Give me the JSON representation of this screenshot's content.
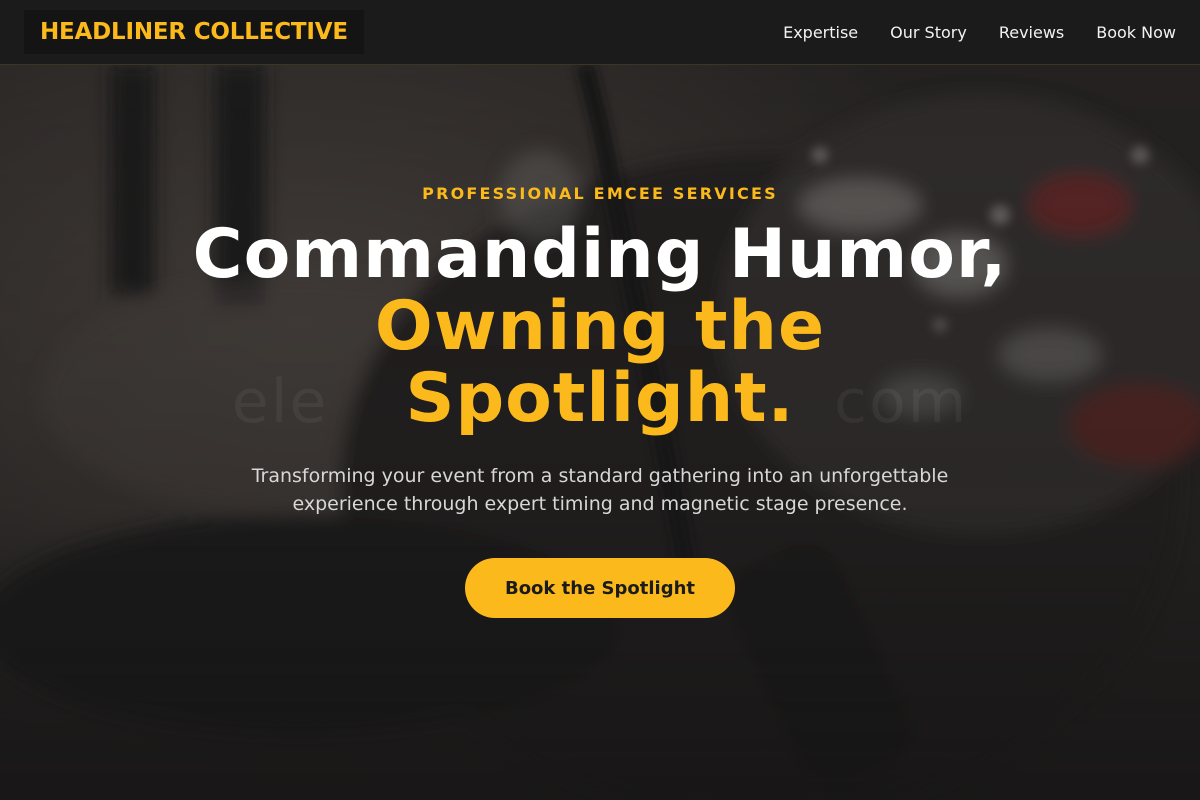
{
  "header": {
    "brand": "HEADLINER COLLECTIVE",
    "nav": [
      {
        "label": "Expertise"
      },
      {
        "label": "Our Story"
      },
      {
        "label": "Reviews"
      },
      {
        "label": "Book Now"
      }
    ]
  },
  "hero": {
    "eyebrow": "PROFESSIONAL EMCEE SERVICES",
    "headline_line1": "Commanding Humor,",
    "headline_line2": "Owning the Spotlight.",
    "subtext": "Transforming your event from a standard gathering into an unforgettable experience through expert timing and magnetic stage presence.",
    "cta_label": "Book the Spotlight"
  },
  "colors": {
    "accent": "#fbb91c",
    "header_bg": "#1b1b1b",
    "text": "#ffffff"
  }
}
